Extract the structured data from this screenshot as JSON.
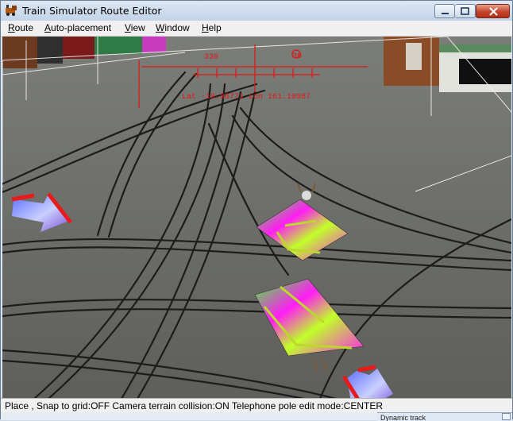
{
  "window": {
    "title": "Train Simulator Route Editor",
    "controls": {
      "minimize_icon": "minimize-icon",
      "maximize_icon": "maximize-icon",
      "close_icon": "close-icon"
    }
  },
  "menubar": {
    "items": [
      {
        "label": "Route",
        "accel": "R",
        "rest": "oute"
      },
      {
        "label": "Auto-placement",
        "accel": "A",
        "rest": "uto-placement"
      },
      {
        "label": "View",
        "accel": "V",
        "rest": "iew"
      },
      {
        "label": "Window",
        "accel": "W",
        "rest": "indow"
      },
      {
        "label": "Help",
        "accel": "H",
        "rest": "elp"
      }
    ]
  },
  "viewport": {
    "hud_lines": {
      "top_left": "330",
      "top_right": "30",
      "coords": "Lat -19.86771 Lon 161.10987"
    },
    "colors": {
      "hud": "#e01818",
      "ground": "#6a6b66",
      "rail": "#1c1c1c",
      "marker_green": "#38ff30",
      "marker_magenta": "#ff19ff"
    }
  },
  "statusbar": {
    "text": "Place , Snap to grid:OFF Camera terrain collision:ON Telephone pole edit mode:CENTER"
  },
  "subpanel": {
    "title": "Dynamic track"
  }
}
